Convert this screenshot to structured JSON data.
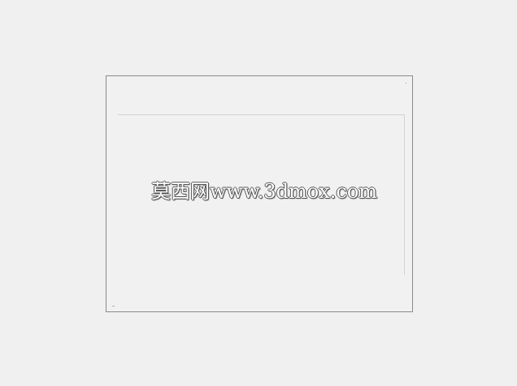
{
  "watermark": {
    "text": "莫西网www.3dmox.com"
  },
  "colors": {
    "background": "#f0f0f0",
    "frame_border": "#8a8a8a",
    "inner_line": "#d2d2d2",
    "watermark_fill": "#ffffff",
    "watermark_outline": "#555555"
  }
}
